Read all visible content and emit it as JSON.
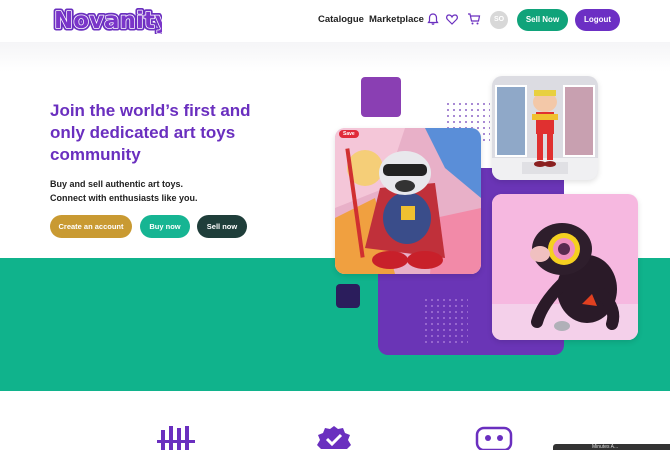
{
  "header": {
    "logo_text": "Novanity",
    "nav": {
      "catalogue": "Catalogue",
      "marketplace": "Marketplace"
    },
    "avatar_initials": "SO",
    "sell_now": "Sell Now",
    "logout": "Logout"
  },
  "hero": {
    "headline_line1": "Join the world’s first and",
    "headline_line2": "only dedicated art toys",
    "headline_line3": "community",
    "sub_line1": "Buy and sell authentic art toys.",
    "sub_line2": "Connect with enthusiasts like you.",
    "btn_create": "Create an account",
    "btn_buy": "Buy now",
    "btn_sell": "Sell now",
    "save_badge": "Save"
  },
  "overlay": {
    "corner_text": "Minutes A..."
  },
  "colors": {
    "brand_purple": "#6a2fbf",
    "green": "#10b38c",
    "gold": "#c99a32",
    "dark_green": "#1f3e3a"
  }
}
